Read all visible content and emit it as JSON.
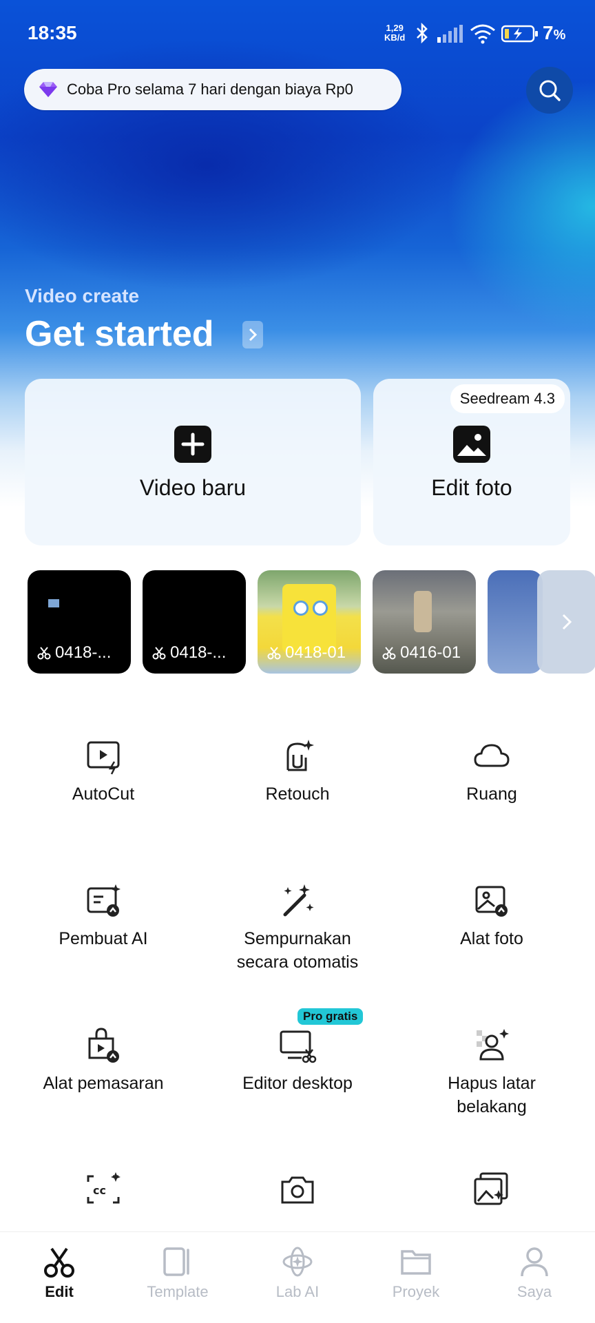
{
  "status_bar": {
    "time": "18:35",
    "net_speed": "1,29",
    "net_unit": "KB/d",
    "battery_pct": "7",
    "battery_unit": "%"
  },
  "promo": {
    "text": "Coba Pro selama 7 hari dengan biaya Rp0"
  },
  "section": {
    "label": "Video create",
    "title": "Get started"
  },
  "cards": {
    "video": {
      "label": "Video baru"
    },
    "photo": {
      "label": "Edit foto",
      "badge": "Seedream 4.3"
    }
  },
  "recent_projects": [
    {
      "name": "0418-..."
    },
    {
      "name": "0418-..."
    },
    {
      "name": "0418-01"
    },
    {
      "name": "0416-01"
    }
  ],
  "tools": [
    {
      "label": "AutoCut",
      "icon": "autocut-icon"
    },
    {
      "label": "Retouch",
      "icon": "retouch-icon"
    },
    {
      "label": "Ruang",
      "icon": "cloud-icon"
    },
    {
      "label": "Pembuat AI",
      "icon": "ai-maker-icon"
    },
    {
      "label": "Sempurnakan secara otomatis",
      "icon": "magic-wand-icon"
    },
    {
      "label": "Alat foto",
      "icon": "photo-tools-icon"
    },
    {
      "label": "Alat pemasaran",
      "icon": "marketing-bag-icon"
    },
    {
      "label": "Editor desktop",
      "icon": "desktop-editor-icon",
      "badge": "Pro gratis"
    },
    {
      "label": "Hapus latar belakang",
      "icon": "remove-background-icon"
    }
  ],
  "bottom_nav": [
    {
      "label": "Edit",
      "icon": "scissors-icon",
      "active": true
    },
    {
      "label": "Template",
      "icon": "template-icon"
    },
    {
      "label": "Lab AI",
      "icon": "ai-lab-icon"
    },
    {
      "label": "Proyek",
      "icon": "folder-icon"
    },
    {
      "label": "Saya",
      "icon": "profile-icon"
    }
  ]
}
